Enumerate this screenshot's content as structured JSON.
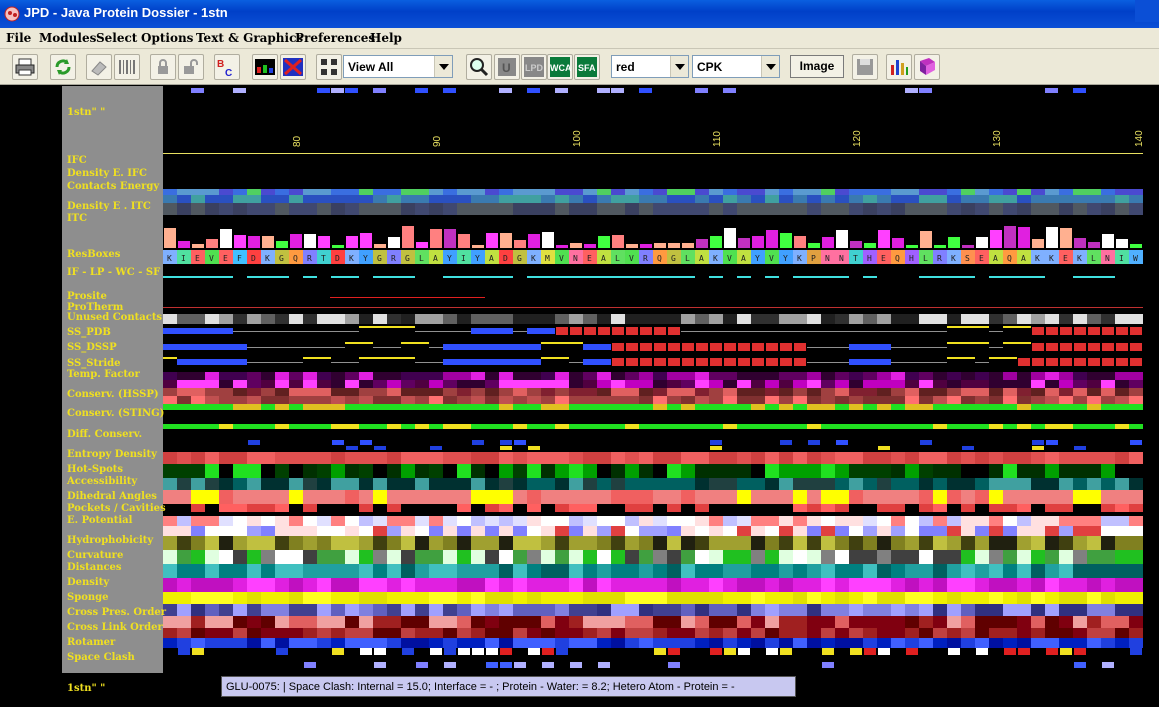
{
  "window": {
    "title": "JPD - Java Protein Dossier - 1stn",
    "bar_color": "#0a5fe0"
  },
  "menu": [
    "File",
    "Modules",
    "Select",
    "Options",
    "Text & Graphics",
    "Preferences",
    "Help"
  ],
  "toolbar": {
    "view_select": "View All",
    "color_select": "red",
    "style_select": "CPK",
    "image_button": "Image",
    "icons": [
      "printer-icon",
      "refresh-icon",
      "eraser-icon",
      "barcode-icon",
      "lock-closed-icon",
      "lock-open-icon",
      "bc-icon",
      "rgb-bars-icon",
      "x-grid-icon",
      "layout-grid-icon",
      "magnifier-icon",
      "unk-icon",
      "lpd-icon",
      "wca-icon",
      "sfa-icon",
      "save-icon",
      "bar-chart-icon",
      "book-icon"
    ]
  },
  "protein": {
    "id_top": "1stn\"  \"",
    "id_bottom": "1stn\"  \""
  },
  "ruler": {
    "ticks": [
      "80",
      "90",
      "100",
      "110",
      "120",
      "130",
      "140"
    ]
  },
  "sequence": "KIEVEFDKGQRTDKYGRGLAYIYADGKMVNEALVRQGLAKVAYVYKPNNTHEQHLRKSEAQAKKEKLNIW",
  "tracks": [
    "IFC",
    "Density E. IFC",
    "Contacts Energy",
    "Density E . ITC",
    "ITC",
    "ResBoxes",
    "IF - LP - WC - SF",
    "Prosite",
    "ProTherm",
    "Unused Contacts",
    "SS_PDB",
    "SS_DSSP",
    "SS_Stride",
    "Temp. Factor",
    "Conserv. (HSSP)",
    "Conserv. (STING)",
    "Diff. Conserv.",
    "Entropy Density",
    "Hot-Spots",
    "Accessibility",
    "Dihedral Angles",
    "Pockets / Cavities",
    "E. Potential",
    "Hydrophobicity",
    "Curvature",
    "Distances",
    "Density",
    "Sponge",
    "Cross Pres. Order",
    "Cross Link Order",
    "Rotamer",
    "Space Clash"
  ],
  "tooltip": "GLU-0075: | Space Clash:  Internal = 15.0; Interface = - ; Protein - Water: =  8.2; Hetero Atom - Protein = -",
  "colors": {
    "label_text": "#f0e020",
    "label_panel": "#8e8e8e",
    "tooltip_bg": "#c8c8f0"
  }
}
